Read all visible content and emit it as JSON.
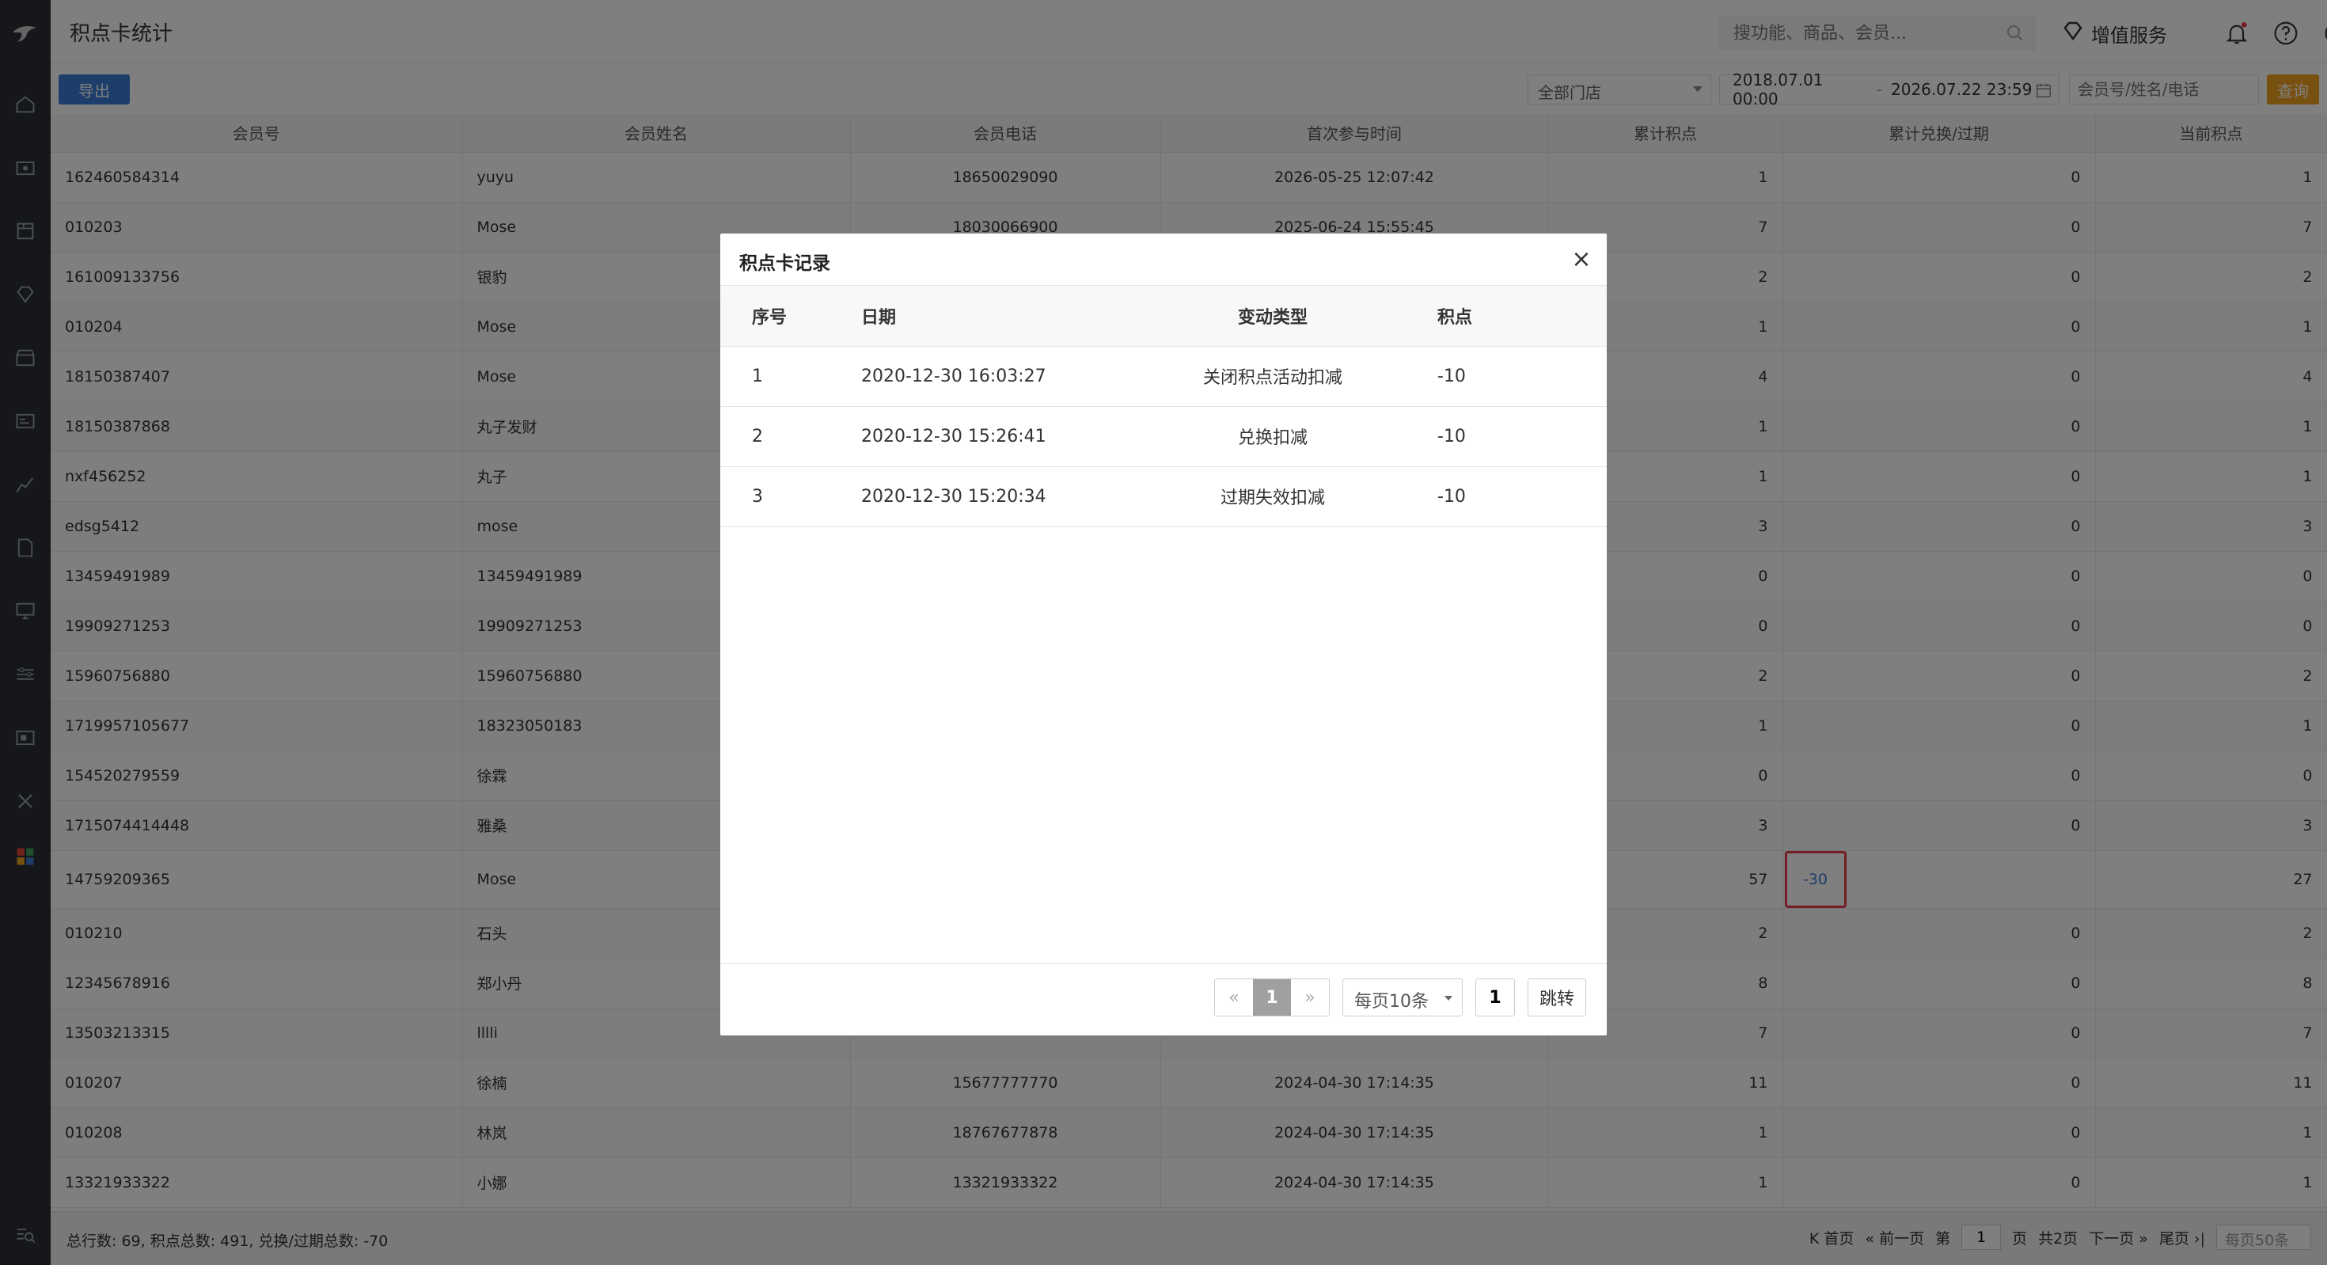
{
  "header": {
    "title": "积点卡统计",
    "search_placeholder": "搜功能、商品、会员...",
    "value_added_service": "增值服务"
  },
  "toolbar": {
    "export_label": "导出",
    "store_select": "全部门店",
    "date_start": "2018.07.01 00:00",
    "date_sep": "-",
    "date_end": "2026.07.22 23:59",
    "member_placeholder": "会员号/姓名/电话",
    "query_label": "查询"
  },
  "table": {
    "columns": [
      "会员号",
      "会员姓名",
      "会员电话",
      "首次参与时间",
      "累计积点",
      "累计兑换/过期",
      "当前积点"
    ],
    "rows": [
      [
        "162460584314",
        "yuyu",
        "18650029090",
        "2026-05-25 12:07:42",
        "1",
        "0",
        "1"
      ],
      [
        "010203",
        "Mose",
        "18030066900",
        "2025-06-24 15:55:45",
        "7",
        "0",
        "7"
      ],
      [
        "161009133756",
        "银豹",
        "",
        "",
        "2",
        "0",
        "2"
      ],
      [
        "010204",
        "Mose",
        "",
        "",
        "1",
        "0",
        "1"
      ],
      [
        "18150387407",
        "Mose",
        "",
        "",
        "4",
        "0",
        "4"
      ],
      [
        "18150387868",
        "丸子发财",
        "",
        "",
        "1",
        "0",
        "1"
      ],
      [
        "nxf456252",
        "丸子",
        "",
        "",
        "1",
        "0",
        "1"
      ],
      [
        "edsg5412",
        "mose",
        "",
        "",
        "3",
        "0",
        "3"
      ],
      [
        "13459491989",
        "13459491989",
        "",
        "",
        "0",
        "0",
        "0"
      ],
      [
        "19909271253",
        "19909271253",
        "",
        "",
        "0",
        "0",
        "0"
      ],
      [
        "15960756880",
        "15960756880",
        "",
        "",
        "2",
        "0",
        "2"
      ],
      [
        "1719957105677",
        "18323050183",
        "",
        "",
        "1",
        "0",
        "1"
      ],
      [
        "154520279559",
        "徐霖",
        "",
        "",
        "0",
        "0",
        "0"
      ],
      [
        "1715074414448",
        "雅桑",
        "",
        "",
        "3",
        "0",
        "3"
      ],
      [
        "14759209365",
        "Mose",
        "",
        "",
        "57",
        "-30",
        "27"
      ],
      [
        "010210",
        "石头",
        "",
        "",
        "2",
        "0",
        "2"
      ],
      [
        "12345678916",
        "郑小丹",
        "",
        "",
        "8",
        "0",
        "8"
      ],
      [
        "13503213315",
        "lllli",
        "",
        "",
        "7",
        "0",
        "7"
      ],
      [
        "010207",
        "徐楠",
        "15677777770",
        "2024-04-30 17:14:35",
        "11",
        "0",
        "11"
      ],
      [
        "010208",
        "林岚",
        "18767677878",
        "2024-04-30 17:14:35",
        "1",
        "0",
        "1"
      ],
      [
        "13321933322",
        "小娜",
        "13321933322",
        "2024-04-30 17:14:35",
        "1",
        "0",
        "1"
      ]
    ]
  },
  "footer": {
    "summary": "总行数: 69, 积点总数: 491, 兑换/过期总数: -70",
    "first": "首页",
    "prev": "前一页",
    "page_prefix": "第",
    "page_value": "1",
    "page_suffix": "页",
    "total_pages": "共2页",
    "next": "下一页",
    "last": "尾页",
    "per_page": "每页50条"
  },
  "modal": {
    "title": "积点卡记录",
    "columns": [
      "序号",
      "日期",
      "变动类型",
      "积点"
    ],
    "rows": [
      [
        "1",
        "2020-12-30 16:03:27",
        "关闭积点活动扣减",
        "-10"
      ],
      [
        "2",
        "2020-12-30 15:26:41",
        "兑换扣减",
        "-10"
      ],
      [
        "3",
        "2020-12-30 15:20:34",
        "过期失效扣减",
        "-10"
      ]
    ],
    "pager": {
      "prev": "«",
      "current": "1",
      "next": "»",
      "per_page": "每页10条",
      "page_input": "1",
      "jump": "跳转"
    }
  },
  "colors": {
    "accent_blue": "#3a7bd5",
    "query_orange": "#f0a020",
    "highlight_red": "#e83a4a",
    "sidebar_bg": "#2b2f36"
  }
}
